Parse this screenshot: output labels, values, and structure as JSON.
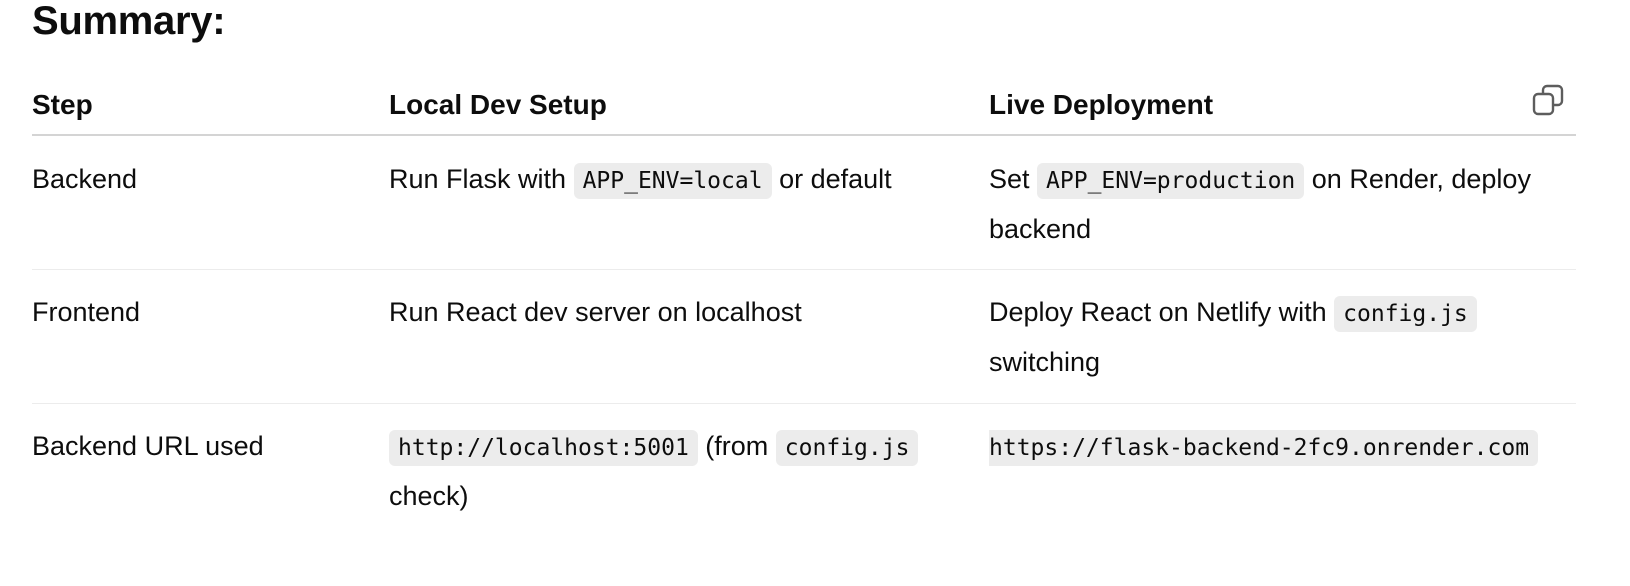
{
  "heading": "Summary:",
  "copy_icon": "copy-icon",
  "table": {
    "headers": [
      "Step",
      "Local Dev Setup",
      "Live Deployment"
    ],
    "rows": [
      {
        "step": "Backend",
        "local": {
          "pre": "Run Flask with ",
          "code": "APP_ENV=local",
          "post": " or default"
        },
        "live": {
          "pre": "Set ",
          "code": "APP_ENV=production",
          "post": " on Render, deploy backend"
        }
      },
      {
        "step": "Frontend",
        "local": {
          "text": "Run React dev server on localhost"
        },
        "live": {
          "pre": "Deploy React on Netlify with ",
          "code": "config.js",
          "post": " switching"
        }
      },
      {
        "step": "Backend URL used",
        "local": {
          "code1": "http://localhost:5001",
          "mid": " (from ",
          "code2": "config.js",
          "post": " check)"
        },
        "live": {
          "code": "https://flask-backend-2fc9.onrender.com"
        }
      }
    ]
  }
}
